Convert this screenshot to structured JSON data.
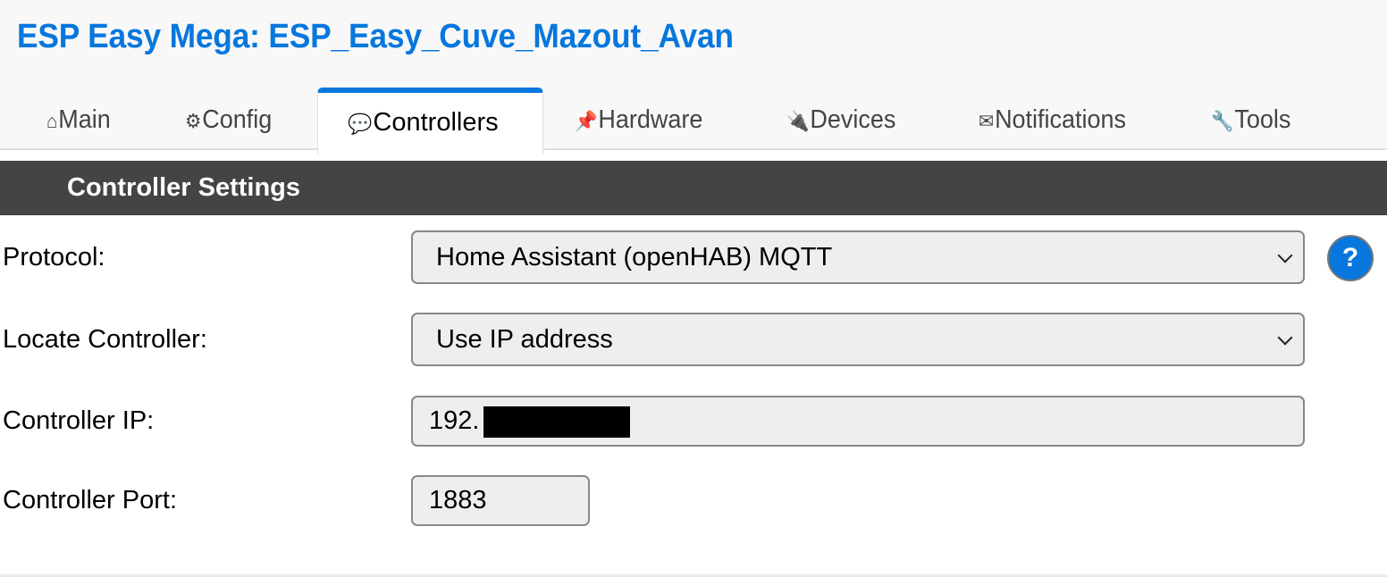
{
  "header": {
    "title": "ESP Easy Mega: ESP_Easy_Cuve_Mazout_Avan"
  },
  "tabs": [
    {
      "label": "Main",
      "icon": "⌂",
      "icon_name": "home-icon",
      "active": false
    },
    {
      "label": "Config",
      "icon": "⚙",
      "icon_name": "gear-icon",
      "active": false
    },
    {
      "label": "Controllers",
      "icon": "💬",
      "icon_name": "speech-bubble-icon",
      "active": true
    },
    {
      "label": "Hardware",
      "icon": "📌",
      "icon_name": "pushpin-icon",
      "active": false
    },
    {
      "label": "Devices",
      "icon": "🔌",
      "icon_name": "plug-icon",
      "active": false
    },
    {
      "label": "Notifications",
      "icon": "✉",
      "icon_name": "envelope-icon",
      "active": false
    },
    {
      "label": "Tools",
      "icon": "🔧",
      "icon_name": "wrench-icon",
      "active": false
    }
  ],
  "section": {
    "title": "Controller Settings"
  },
  "form": {
    "protocol": {
      "label": "Protocol:",
      "value": "Home Assistant (openHAB) MQTT"
    },
    "locate": {
      "label": "Locate Controller:",
      "value": "Use IP address"
    },
    "ip": {
      "label": "Controller IP:",
      "value": "192."
    },
    "port": {
      "label": "Controller Port:",
      "value": "1883"
    },
    "help_label": "?"
  },
  "colors": {
    "accent": "#0777dd",
    "header_bar": "#444444",
    "field_bg": "#eeeeee"
  }
}
